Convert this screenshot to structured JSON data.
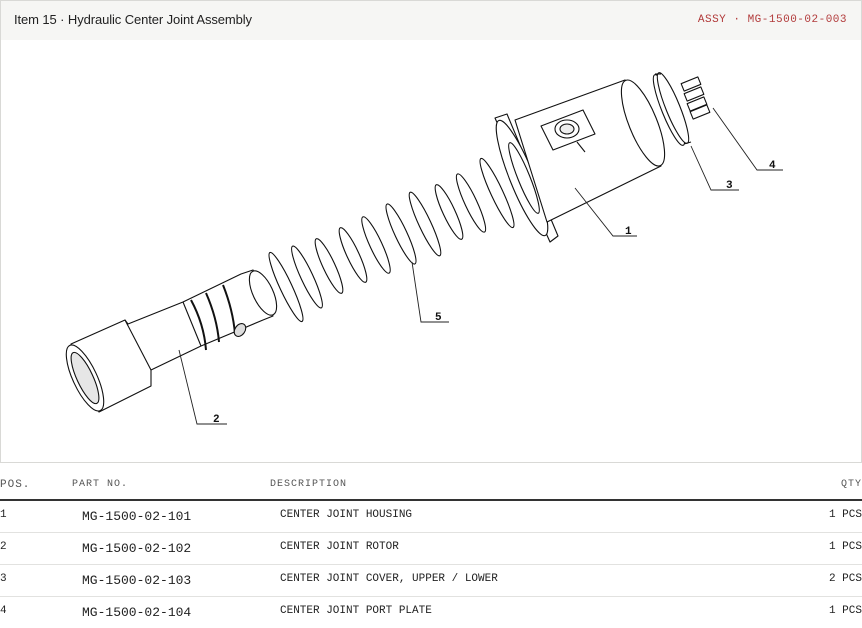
{
  "header": {
    "title": "Item 15 · Hydraulic Center Joint Assembly",
    "assembly": "ASSY · MG-1500-02-003"
  },
  "drawing": {
    "callouts": [
      "1",
      "2",
      "3",
      "4",
      "5"
    ]
  },
  "table": {
    "headers": {
      "pos": "POS.",
      "part_no": "PART NO.",
      "description": "DESCRIPTION",
      "qty": "QTY"
    },
    "rows": [
      {
        "pos": "1",
        "part_no": "MG-1500-02-101",
        "description": "CENTER JOINT HOUSING",
        "qty": "1 PCS"
      },
      {
        "pos": "2",
        "part_no": "MG-1500-02-102",
        "description": "CENTER JOINT ROTOR",
        "qty": "1 PCS"
      },
      {
        "pos": "3",
        "part_no": "MG-1500-02-103",
        "description": "CENTER JOINT COVER, UPPER / LOWER",
        "qty": "2 PCS"
      },
      {
        "pos": "4",
        "part_no": "MG-1500-02-104",
        "description": "CENTER JOINT PORT PLATE",
        "qty": "1 PCS"
      }
    ]
  }
}
